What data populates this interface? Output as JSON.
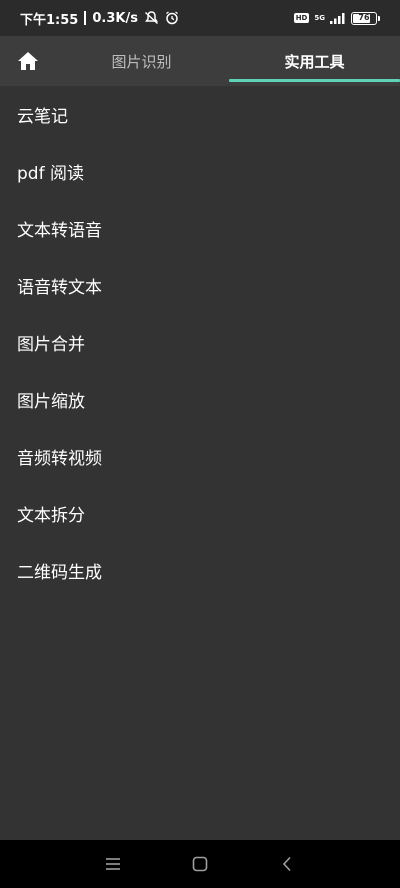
{
  "status_bar": {
    "time": "下午1:55",
    "speed": "0.3K/s",
    "hd_label": "HD",
    "network": "5G",
    "battery_level": "76",
    "battery_fraction": 0.76,
    "icons": [
      "mute-icon",
      "alarm-icon",
      "signal-icon",
      "battery-icon"
    ]
  },
  "app_bar": {
    "home_icon": "home-icon",
    "tabs": [
      {
        "label": "图片识别",
        "active": false
      },
      {
        "label": "实用工具",
        "active": true
      }
    ],
    "accent_color": "#5fd3b5"
  },
  "menu": {
    "items": [
      {
        "label": "云笔记"
      },
      {
        "label": "pdf 阅读"
      },
      {
        "label": "文本转语音"
      },
      {
        "label": "语音转文本"
      },
      {
        "label": "图片合并"
      },
      {
        "label": "图片缩放"
      },
      {
        "label": "音频转视频"
      },
      {
        "label": "文本拆分"
      },
      {
        "label": "二维码生成"
      }
    ]
  },
  "nav_bar": {
    "icons": [
      "menu-icon",
      "home-square-icon",
      "back-icon"
    ]
  },
  "colors": {
    "background": "#333333",
    "app_bar": "#3d3d3d",
    "status_bar": "#2b2b2b",
    "nav_bar": "#000000"
  }
}
